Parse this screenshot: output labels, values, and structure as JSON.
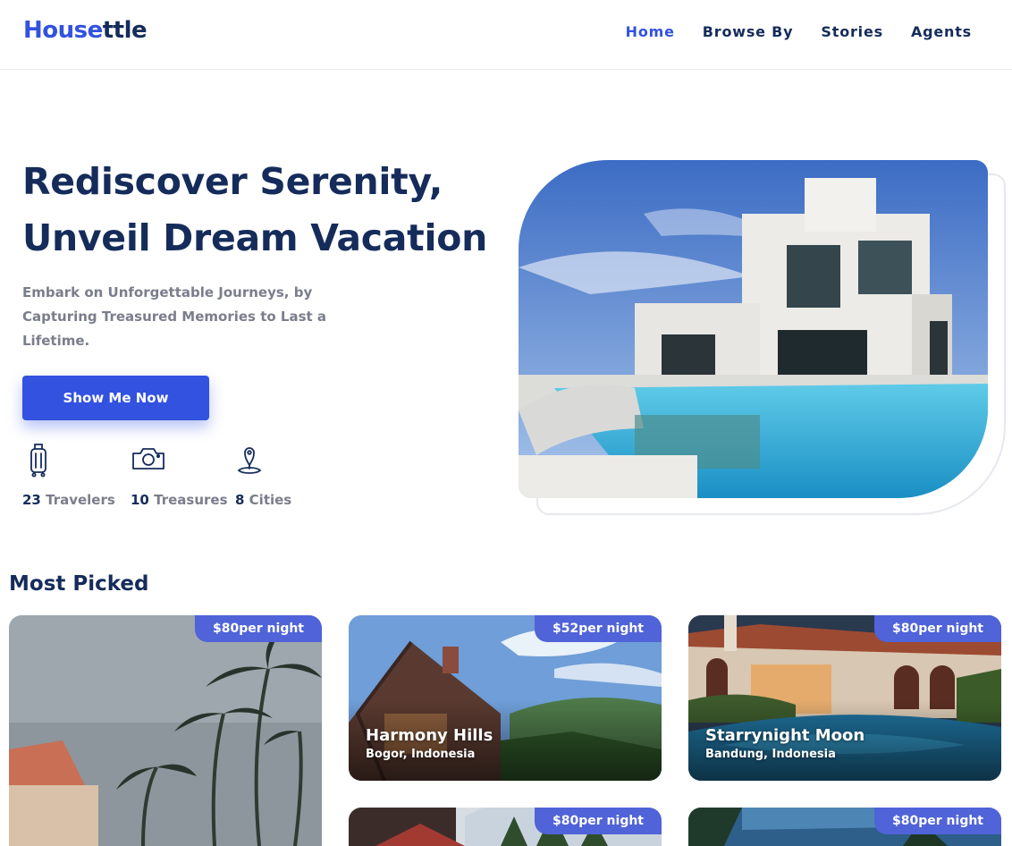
{
  "header": {
    "logo_part1": "House",
    "logo_part2": "ttle",
    "nav": [
      "Home",
      "Browse By",
      "Stories",
      "Agents"
    ],
    "active_nav": "Home"
  },
  "hero": {
    "title_line1": "Rediscover Serenity,",
    "title_line2": "Unveil Dream Vacation",
    "subtitle": "Embark on Unforgettable Journeys, by Capturing Treasured Memories to Last a Lifetime.",
    "cta_label": "Show Me Now",
    "stats": [
      {
        "icon": "suitcase-icon",
        "number": "23",
        "label": "Travelers"
      },
      {
        "icon": "camera-icon",
        "number": "10",
        "label": "Treasures"
      },
      {
        "icon": "map-pin-icon",
        "number": "8",
        "label": "Cities"
      }
    ]
  },
  "most_picked": {
    "title": "Most Picked",
    "cards": [
      {
        "price": "$80per night"
      },
      {
        "price": "$52per night",
        "name": "Harmony Hills",
        "location": "Bogor, Indonesia"
      },
      {
        "price": "$80per night",
        "name": "Starrynight Moon",
        "location": "Bandung, Indonesia"
      },
      {
        "price": "$80per night"
      },
      {
        "price": "$80per night"
      }
    ]
  },
  "colors": {
    "primary": "#3252df",
    "navy": "#152c5b",
    "gray_text": "#7a7e8c",
    "price_badge": "#5063d8"
  }
}
